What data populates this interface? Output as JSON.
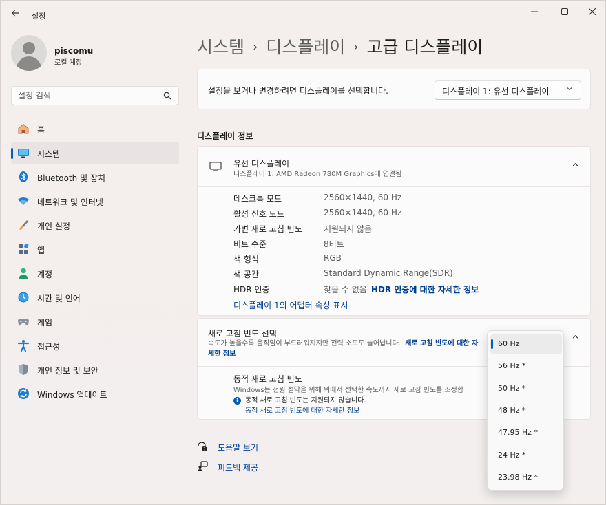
{
  "window": {
    "title": "설정"
  },
  "user": {
    "name": "piscomu",
    "account_type": "로컬 계정"
  },
  "search": {
    "placeholder": "설정 검색"
  },
  "sidebar": {
    "items": [
      {
        "label": "홈",
        "icon": "home-icon",
        "active": false
      },
      {
        "label": "시스템",
        "icon": "system-icon",
        "active": true
      },
      {
        "label": "Bluetooth 및 장치",
        "icon": "bluetooth-icon",
        "active": false
      },
      {
        "label": "네트워크 및 인터넷",
        "icon": "wifi-icon",
        "active": false
      },
      {
        "label": "개인 설정",
        "icon": "brush-icon",
        "active": false
      },
      {
        "label": "앱",
        "icon": "apps-icon",
        "active": false
      },
      {
        "label": "계정",
        "icon": "account-icon",
        "active": false
      },
      {
        "label": "시간 및 언어",
        "icon": "globe-icon",
        "active": false
      },
      {
        "label": "게임",
        "icon": "gamepad-icon",
        "active": false
      },
      {
        "label": "접근성",
        "icon": "accessibility-icon",
        "active": false
      },
      {
        "label": "개인 정보 및 보안",
        "icon": "shield-icon",
        "active": false
      },
      {
        "label": "Windows 업데이트",
        "icon": "update-icon",
        "active": false
      }
    ]
  },
  "breadcrumb": {
    "level1": "시스템",
    "level2": "디스플레이",
    "current": "고급 디스플레이"
  },
  "monitor_select": {
    "label": "설정을 보거나 변경하려면 디스플레이를 선택합니다.",
    "value": "디스플레이 1: 유선 디스플레이"
  },
  "display_info": {
    "section_title": "디스플레이 정보",
    "name": "유선 디스플레이",
    "subtitle": "디스플레이 1: AMD Radeon 780M Graphics에 연결됨",
    "properties": [
      {
        "key": "데스크톱 모드",
        "value": "2560×1440, 60 Hz"
      },
      {
        "key": "활성 신호 모드",
        "value": "2560×1440, 60 Hz"
      },
      {
        "key": "가변 새로 고침 빈도",
        "value": "지원되지 않음"
      },
      {
        "key": "비트 수준",
        "value": "8비트"
      },
      {
        "key": "색 형식",
        "value": "RGB"
      },
      {
        "key": "색 공간",
        "value": "Standard Dynamic Range(SDR)"
      },
      {
        "key": "HDR 인증",
        "value": "찾을 수 없음",
        "link": "HDR 인증에 대한 자세한 정보"
      }
    ],
    "adapter_link": "디스플레이 1의 어댑터 속성 표시"
  },
  "refresh": {
    "title": "새로 고침 빈도 선택",
    "description": "속도가 높을수록 움직임이 부드러워지지만 전력 소모도 늘어납니다.",
    "description_link": "새로 고침 빈도에 대한 자세한 정보",
    "dynamic_title": "동적 새로 고침 빈도",
    "dynamic_desc": "Windows는 전원 절약을 위해 위에서 선택한 속도까지 새로 고침 빈도를 조정합",
    "dynamic_note": "동적 새로 고침 빈도는 지원되지 않습니다.",
    "dynamic_link": "동적 새로 고침 빈도에 대한 자세한 정보"
  },
  "help": {
    "get_help": "도움말 보기",
    "feedback": "피드백 제공"
  },
  "refresh_dropdown": {
    "options": [
      "60 Hz",
      "56 Hz *",
      "50 Hz *",
      "48 Hz *",
      "47.95 Hz *",
      "24 Hz *",
      "23.98 Hz *"
    ],
    "selected": "60 Hz"
  },
  "colors": {
    "accent": "#005fb8",
    "link": "#003e92"
  }
}
